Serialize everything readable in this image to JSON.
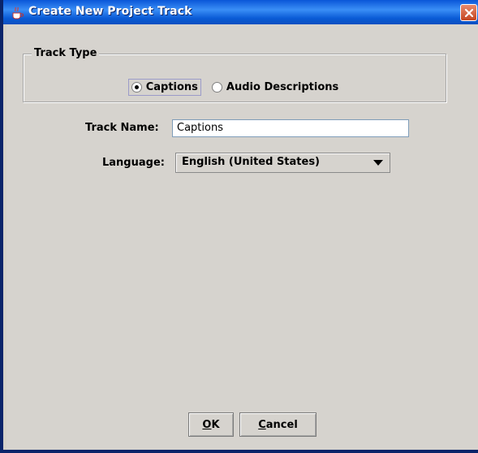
{
  "window": {
    "title": "Create New Project Track"
  },
  "track_type": {
    "legend": "Track Type",
    "options": [
      {
        "label": "Captions",
        "selected": true
      },
      {
        "label": "Audio Descriptions",
        "selected": false
      }
    ]
  },
  "track_name": {
    "label": "Track Name:",
    "value": "Captions"
  },
  "language": {
    "label": "Language:",
    "selected": "English (United States)"
  },
  "buttons": {
    "ok": {
      "mnemonic": "O",
      "rest": "K"
    },
    "cancel": {
      "mnemonic": "C",
      "rest": "ancel"
    }
  },
  "colors": {
    "titlebar": "#0a56d8",
    "dialog_bg": "#d6d3ce",
    "close_button": "#c4441f"
  }
}
